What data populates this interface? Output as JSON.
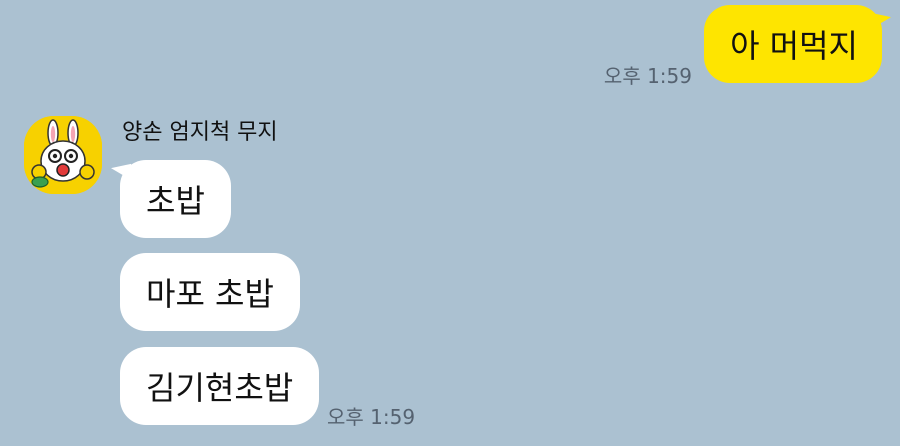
{
  "outgoing": {
    "text": "아 머먹지",
    "time": "오후 1:59"
  },
  "incoming": {
    "sender": "양손 엄지척 무지",
    "avatar_icon": "muzi-thumbs-up-icon",
    "messages": [
      {
        "text": "초밥"
      },
      {
        "text": "마포 초밥"
      },
      {
        "text": "김기현초밥"
      }
    ],
    "time": "오후 1:59"
  },
  "colors": {
    "background": "#abc1d1",
    "outgoing_bubble": "#fee500",
    "incoming_bubble": "#ffffff",
    "timestamp": "#556270",
    "avatar_bg": "#f7d100"
  }
}
